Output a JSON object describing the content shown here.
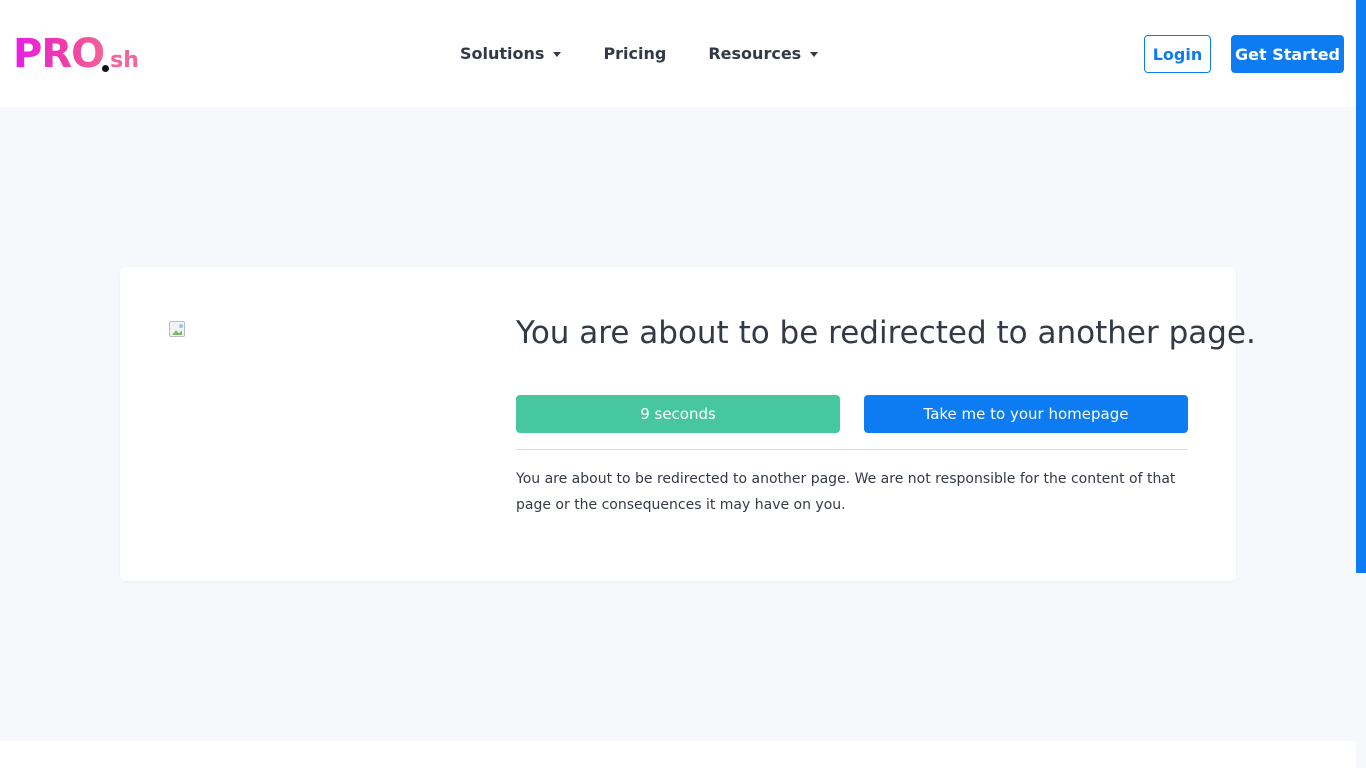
{
  "brand": {
    "logo_main": "PRO",
    "logo_sub": "sh"
  },
  "nav": {
    "items": [
      {
        "label": "Solutions",
        "has_dropdown": true
      },
      {
        "label": "Pricing",
        "has_dropdown": false
      },
      {
        "label": "Resources",
        "has_dropdown": true
      }
    ],
    "login_label": "Login",
    "get_started_label": "Get Started"
  },
  "redirect": {
    "title": "You are about to be redirected to another page.",
    "countdown_label": "9 seconds",
    "home_button_label": "Take me to your homepage",
    "message": "You are about to be redirected to another page. We are not responsible for the content of that page or the consequences it may have on you."
  },
  "icons": {
    "caret": "chevron-down-icon",
    "image": "broken-image-icon"
  },
  "colors": {
    "primary": "#0d7cf2",
    "success": "#47c79d",
    "logo_gradient_start": "#e81ee8",
    "logo_gradient_end": "#f4639a",
    "background": "#f6f8fc",
    "text": "#333a45"
  }
}
